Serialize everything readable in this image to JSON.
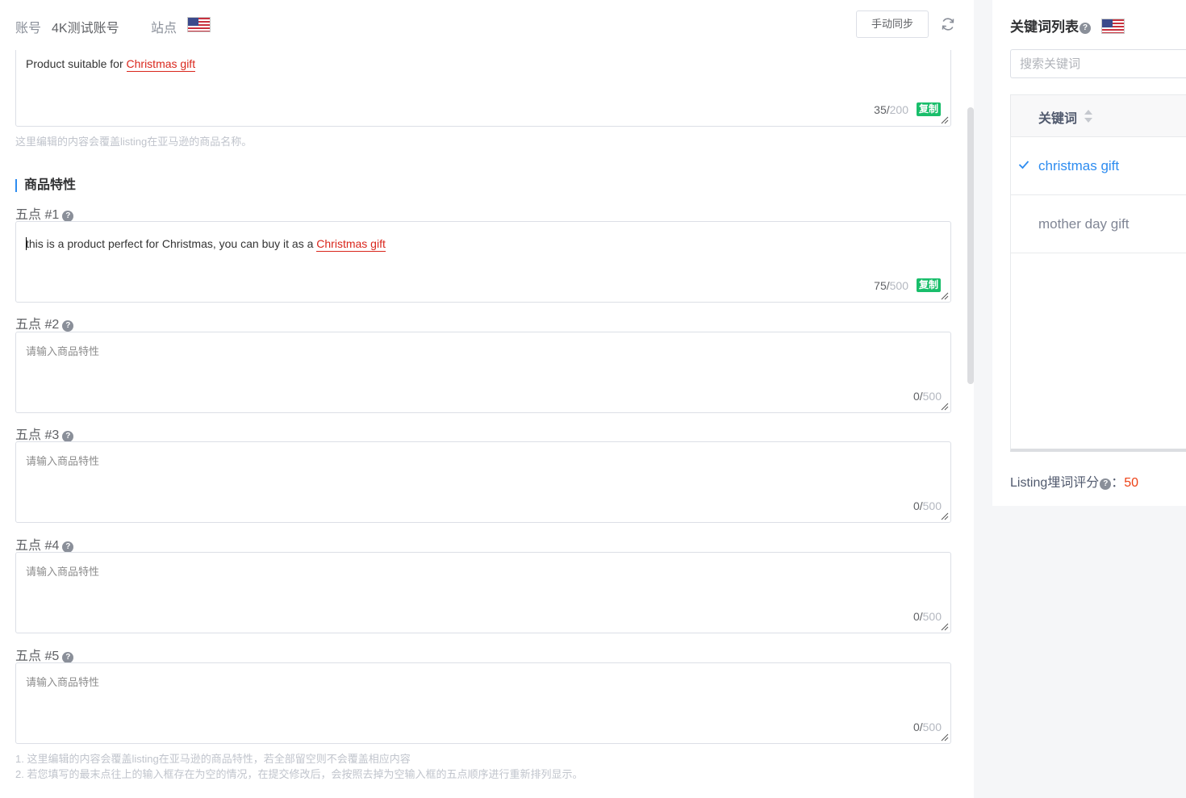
{
  "topbar": {
    "account_label": "账号",
    "account_value": "4K测试账号",
    "site_label": "站点",
    "site_flag": "us-flag-icon",
    "sync_button": "手动同步",
    "refresh_icon": "refresh-icon"
  },
  "title_field": {
    "text_before": "Product suitable for ",
    "keyword": "Christmas gift",
    "count": "35",
    "max": "200",
    "copy_label": "复制",
    "hint": "这里编辑的内容会覆盖listing在亚马逊的商品名称。"
  },
  "features_section": {
    "title": "商品特性",
    "placeholder": "请输入商品特性",
    "bullets": [
      {
        "label": "五点 #1",
        "text_before": "this is a product perfect for Christmas, you can buy it as a ",
        "keyword": "Christmas gift",
        "count": "75",
        "max": "500",
        "copy_label": "复制"
      },
      {
        "label": "五点 #2",
        "count": "0",
        "max": "500"
      },
      {
        "label": "五点 #3",
        "count": "0",
        "max": "500"
      },
      {
        "label": "五点 #4",
        "count": "0",
        "max": "500"
      },
      {
        "label": "五点 #5",
        "count": "0",
        "max": "500"
      }
    ],
    "notes": [
      "1. 这里编辑的内容会覆盖listing在亚马逊的商品特性，若全部留空则不会覆盖相应内容",
      "2. 若您填写的最末点往上的输入框存在为空的情况，在提交修改后，会按照去掉为空输入框的五点顺序进行重新排列显示。"
    ]
  },
  "sidebar": {
    "title": "关键词列表",
    "search_placeholder": "搜索关键词",
    "column_header": "关键词",
    "keywords": [
      {
        "text": "christmas gift",
        "matched": true
      },
      {
        "text": "mother day gift",
        "matched": false
      }
    ],
    "score_label": "Listing埋词评分",
    "score_colon": "：",
    "score_value": "50"
  },
  "colors": {
    "accent_blue": "#2d8cf0",
    "keyword_hit_red": "#d9261c",
    "copy_green": "#19be6b",
    "score_red": "#ed4014"
  }
}
